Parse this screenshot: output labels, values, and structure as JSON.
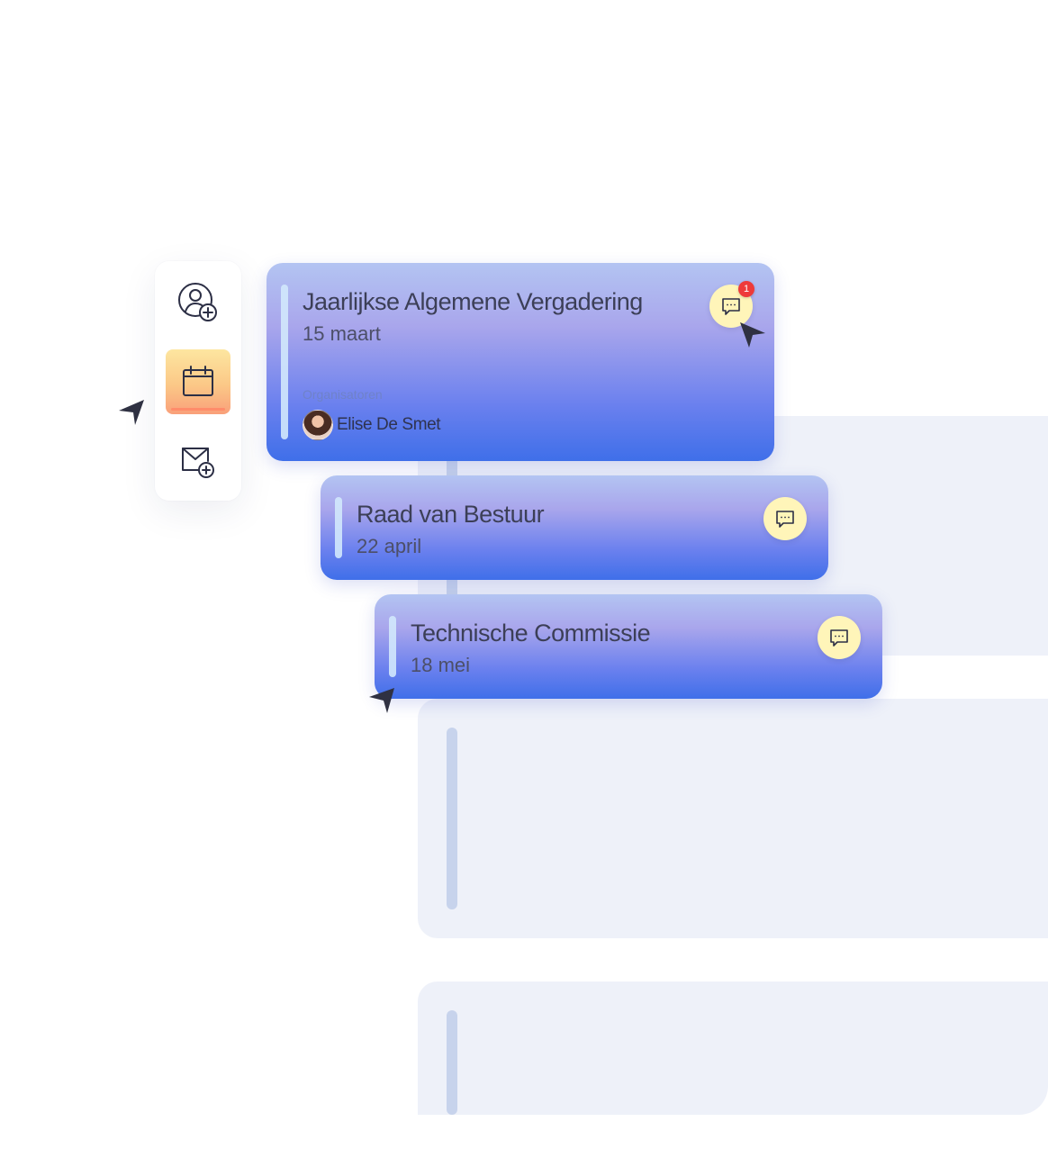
{
  "sidebar": {
    "items": [
      {
        "icon": "user-add-icon",
        "active": false
      },
      {
        "icon": "calendar-icon",
        "active": true
      },
      {
        "icon": "mail-add-icon",
        "active": false
      }
    ],
    "active_gradient": [
      "#fde6a0",
      "#f9a07a"
    ]
  },
  "meetings": [
    {
      "title": "Jaarlijkse Algemene Vergadering",
      "date": "15 maart",
      "organizers_label": "Organisatoren",
      "organizer_name": "Elise De Smet",
      "chat_icon": "chat-icon",
      "unread_count": "1"
    },
    {
      "title": "Raad van Bestuur",
      "date": "22 april",
      "chat_icon": "chat-icon"
    },
    {
      "title": "Technische Commissie",
      "date": "18 mei",
      "chat_icon": "chat-icon"
    }
  ],
  "colors": {
    "card_gradient_top": "#b3c4f2",
    "card_gradient_bottom": "#3f6fe9",
    "chat_button": "#fff5b9",
    "badge": "#ee3a3a",
    "background_panel": "#eef1f9"
  }
}
